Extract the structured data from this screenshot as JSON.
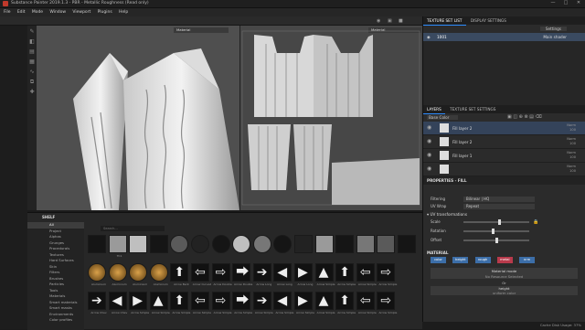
{
  "window": {
    "title": "Substance Painter 2019.1.3 - PBR - Metallic Roughness (Read only)",
    "minimize": "—",
    "maximize": "□",
    "close": "✕"
  },
  "menu": [
    "File",
    "Edit",
    "Mode",
    "Window",
    "Viewport",
    "Plugins",
    "Help"
  ],
  "viewport3d": {
    "label": "Material"
  },
  "viewport2d": {
    "label": "Material"
  },
  "texture_set": {
    "tabs": [
      "TEXTURE SET LIST",
      "DISPLAY SETTINGS"
    ],
    "settings_label": "Settings",
    "item": "1001",
    "shader": "Main shader"
  },
  "layers": {
    "tabs": [
      "LAYERS",
      "TEXTURE SET SETTINGS"
    ],
    "channel": "Base Color",
    "items": [
      {
        "name": "Fill layer 2",
        "blend": "Norm",
        "opacity": "100"
      },
      {
        "name": "Fill layer 2",
        "blend": "Norm",
        "opacity": "100"
      },
      {
        "name": "Fill layer 1",
        "blend": "Norm",
        "opacity": "100"
      },
      {
        "name": "",
        "blend": "Norm",
        "opacity": "100"
      }
    ]
  },
  "properties": {
    "title": "PROPERTIES - FILL",
    "filtering_label": "Filtering",
    "filtering_value": "Bilinear | HQ",
    "uvwrap_label": "UV Wrap",
    "uvwrap_value": "Repeat",
    "uv_section": "UV transformations",
    "scale_label": "Scale",
    "rotation_label": "Rotation",
    "offset_label": "Offset",
    "scale_val": "",
    "rotation_val": "",
    "offset_val": "",
    "material_section": "MATERIAL",
    "mat_buttons": [
      "color",
      "height",
      "rough",
      "metal",
      "nrm"
    ],
    "material_mode": "Material mode",
    "material_mode_sub": "No Resource Selected",
    "or": "Or",
    "height_label": "height",
    "height_sub": "uniform color",
    "scale_frac": 0.55,
    "rotation_frac": 0.45,
    "offset_frac": 0.5
  },
  "shelf": {
    "title": "SHELF",
    "search_placeholder": "Search...",
    "categories": [
      "All",
      "Project",
      "Alphas",
      "Grunges",
      "Procedurals",
      "Textures",
      "Hard Surfaces",
      "Skin",
      "Filters",
      "Brushes",
      "Particles",
      "Tools",
      "Materials",
      "Smart materials",
      "Smart masks",
      "Environments",
      "Color profiles"
    ],
    "tiles_row1": [
      "",
      "TC1",
      "",
      "",
      "",
      "",
      "",
      "",
      "",
      "",
      "",
      "",
      "",
      "",
      "",
      "",
      "",
      "White"
    ],
    "tiles_row2": [
      "Aluminium",
      "Aluminium",
      "Aluminium",
      "Aluminium",
      "Arrow Bent",
      "Arrow Curved",
      "Arrow Double",
      "Arrow Double",
      "Arrow Long",
      "Arrow Long",
      "Arrow Long",
      "Arrow Simple",
      "Arrow Simple",
      "Arrow Simple",
      "Arrow Simple"
    ],
    "tiles_row3": [
      "Arrow Chev",
      "Arrow Chev",
      "Arrow Simple",
      "Arrow Simple",
      "Arrow Simple",
      "Arrow Simple",
      "Arrow Simple",
      "Arrow Simple",
      "Arrow Simple",
      "Arrow Simple",
      "Arrow Simple",
      "Arrow Simple",
      "Arrow Simple",
      "Arrow Simple",
      "Arrow Simple"
    ]
  },
  "status": {
    "text": "Cache Disk Usage: 37%"
  },
  "colors": {
    "accent": "#2d8cff",
    "bg": "#1b1b1b",
    "panel": "#2b2b2b"
  }
}
